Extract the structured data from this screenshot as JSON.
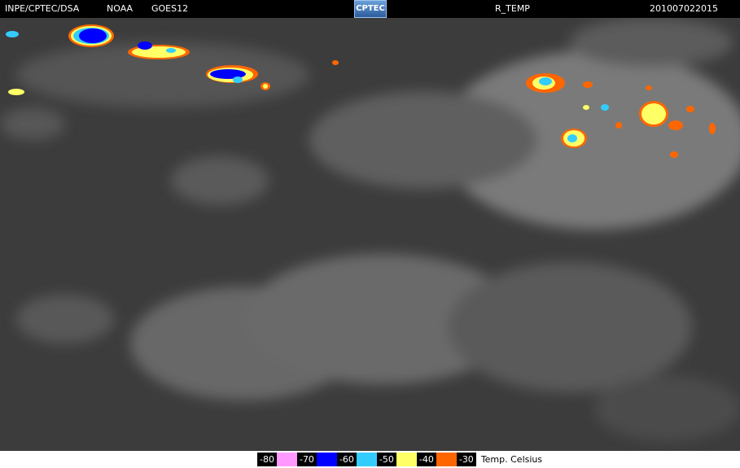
{
  "header": {
    "source": "INPE/CPTEC/DSA",
    "agency": "NOAA",
    "satellite": "GOES12",
    "logo_text": "CPTEC",
    "product": "R_TEMP",
    "timestamp": "201007022015"
  },
  "legend": {
    "items": [
      {
        "label": "-80",
        "color": "#ff99ff"
      },
      {
        "label": "-70",
        "color": "#0000ff"
      },
      {
        "label": "-60",
        "color": "#33ccff"
      },
      {
        "label": "-50",
        "color": "#ffff66"
      },
      {
        "label": "-40",
        "color": "#ff6600"
      },
      {
        "label": "-30",
        "color": ""
      }
    ],
    "unit": "Temp. Celsius"
  }
}
